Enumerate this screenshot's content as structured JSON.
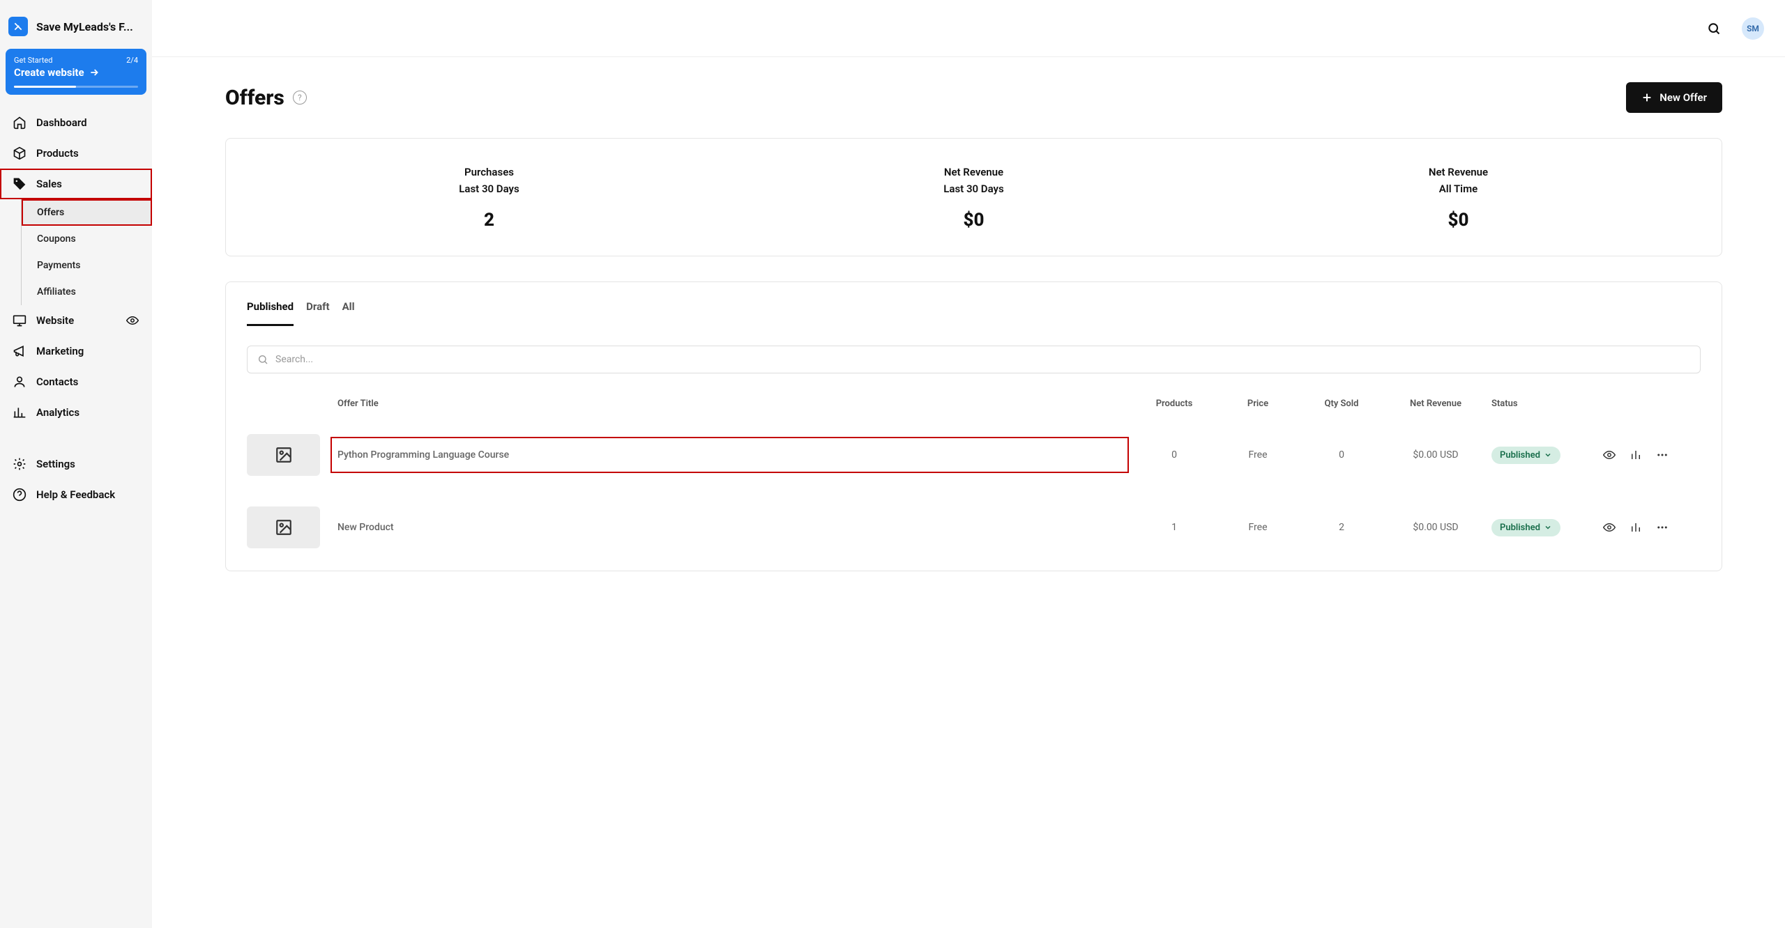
{
  "site_title": "Save MyLeads's F...",
  "onboarding": {
    "label": "Get Started",
    "progress": "2/4",
    "cta": "Create website"
  },
  "nav": {
    "dashboard": "Dashboard",
    "products": "Products",
    "sales": "Sales",
    "website": "Website",
    "marketing": "Marketing",
    "contacts": "Contacts",
    "analytics": "Analytics",
    "settings": "Settings",
    "help": "Help & Feedback"
  },
  "subnav": {
    "offers": "Offers",
    "coupons": "Coupons",
    "payments": "Payments",
    "affiliates": "Affiliates"
  },
  "avatar_initials": "SM",
  "page": {
    "title": "Offers",
    "new_button": "New Offer"
  },
  "stats": [
    {
      "label1": "Purchases",
      "label2": "Last 30 Days",
      "value": "2"
    },
    {
      "label1": "Net Revenue",
      "label2": "Last 30 Days",
      "value": "$0"
    },
    {
      "label1": "Net Revenue",
      "label2": "All Time",
      "value": "$0"
    }
  ],
  "tabs": {
    "published": "Published",
    "draft": "Draft",
    "all": "All"
  },
  "search_placeholder": "Search...",
  "columns": {
    "title": "Offer Title",
    "products": "Products",
    "price": "Price",
    "qty": "Qty Sold",
    "revenue": "Net Revenue",
    "status": "Status"
  },
  "rows": [
    {
      "title": "Python Programming Language Course",
      "products": "0",
      "price": "Free",
      "qty": "0",
      "revenue": "$0.00 USD",
      "status": "Published"
    },
    {
      "title": "New Product",
      "products": "1",
      "price": "Free",
      "qty": "2",
      "revenue": "$0.00 USD",
      "status": "Published"
    }
  ]
}
